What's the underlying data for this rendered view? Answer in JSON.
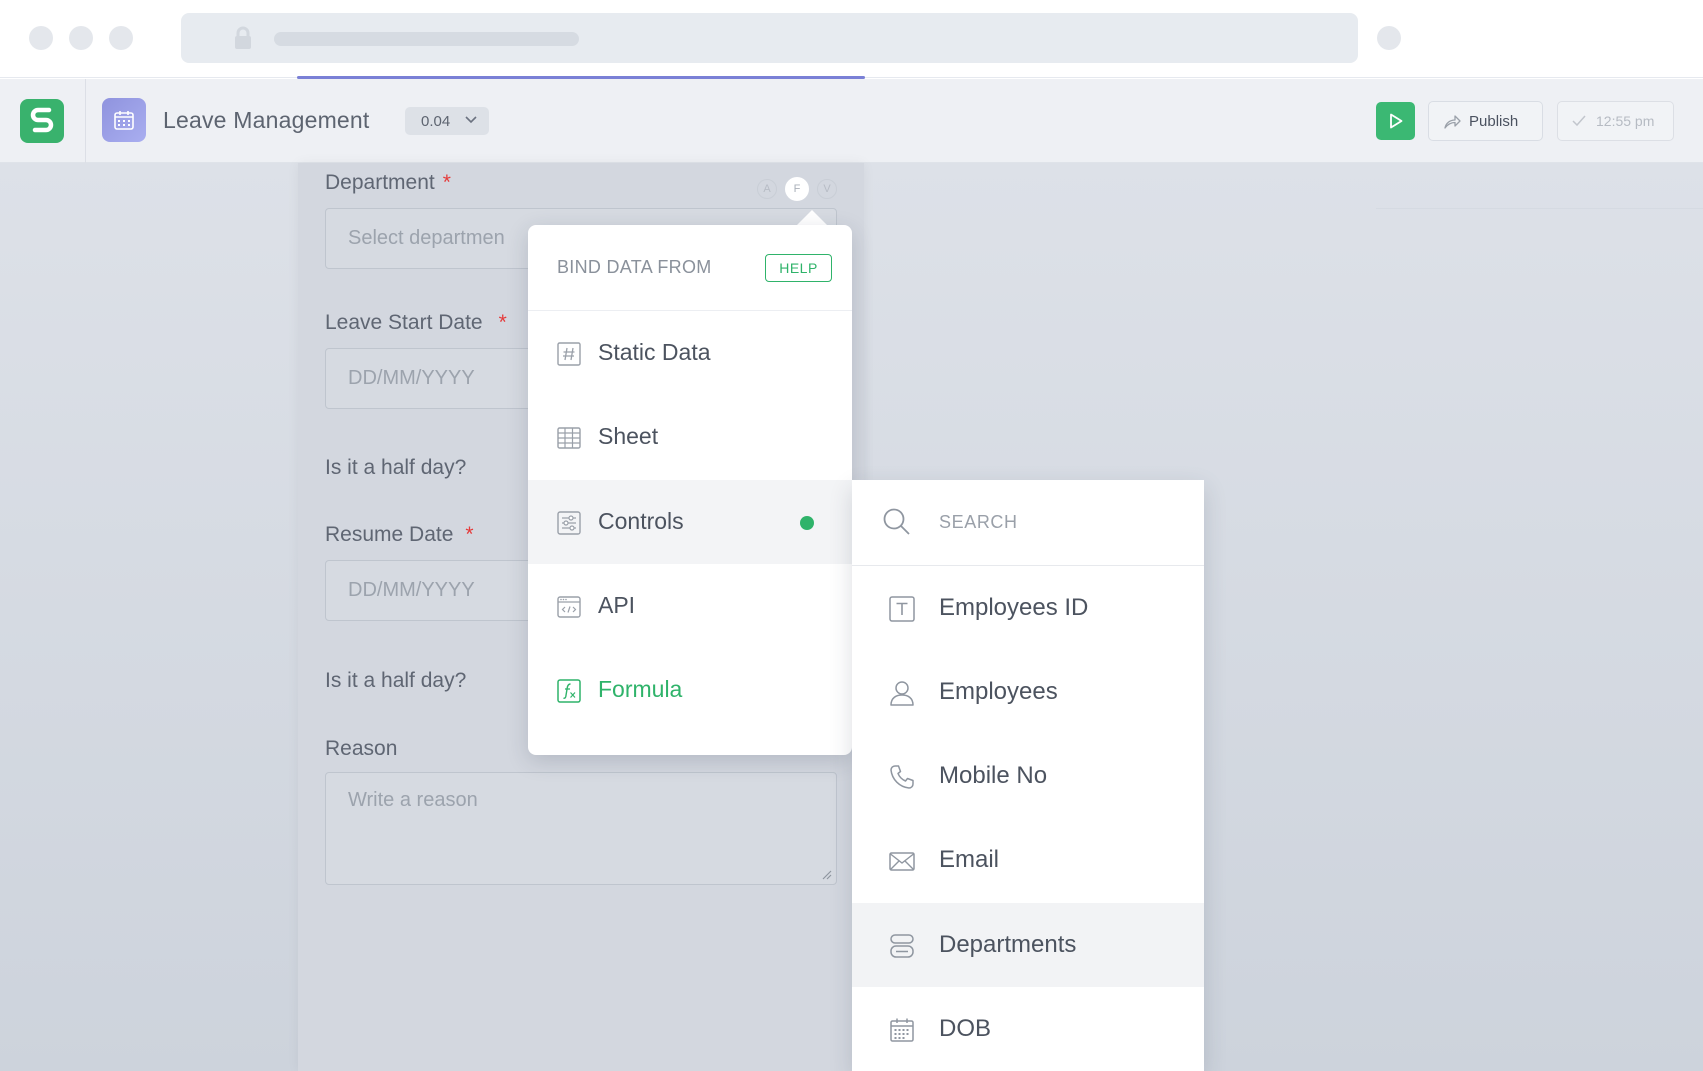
{
  "app": {
    "title": "Leave Management",
    "version": "0.04",
    "publish_label": "Publish",
    "saved_time": "12:55 pm"
  },
  "form": {
    "department": {
      "label": "Department",
      "required": "*",
      "placeholder": "Select departmen"
    },
    "leave_start": {
      "label": "Leave Start Date",
      "required": "*",
      "placeholder": "DD/MM/YYYY"
    },
    "half_day_1": {
      "label": "Is it a half day?"
    },
    "resume": {
      "label": "Resume Date",
      "required": "*",
      "placeholder": "DD/MM/YYYY"
    },
    "half_day_2": {
      "label": "Is it a half day?"
    },
    "reason": {
      "label": "Reason",
      "placeholder": "Write a reason"
    },
    "binding_tabs": [
      "A",
      "F",
      "V"
    ]
  },
  "bind_menu": {
    "title": "BIND DATA FROM",
    "help_label": "HELP",
    "items": [
      {
        "label": "Static Data",
        "icon": "hash-icon"
      },
      {
        "label": "Sheet",
        "icon": "grid-icon"
      },
      {
        "label": "Controls",
        "icon": "sliders-icon"
      },
      {
        "label": "API",
        "icon": "code-window-icon"
      },
      {
        "label": "Formula",
        "icon": "formula-icon"
      }
    ],
    "active_item": "Controls",
    "accent_color": "#2fb36a"
  },
  "controls_menu": {
    "search_placeholder": "SEARCH",
    "items": [
      {
        "label": "Employees ID",
        "icon": "text-field-icon"
      },
      {
        "label": "Employees",
        "icon": "user-icon"
      },
      {
        "label": "Mobile No",
        "icon": "phone-icon"
      },
      {
        "label": "Email",
        "icon": "mail-icon"
      },
      {
        "label": "Departments",
        "icon": "dropdown-icon"
      },
      {
        "label": "DOB",
        "icon": "calendar-icon"
      }
    ],
    "active_item": "Departments"
  }
}
